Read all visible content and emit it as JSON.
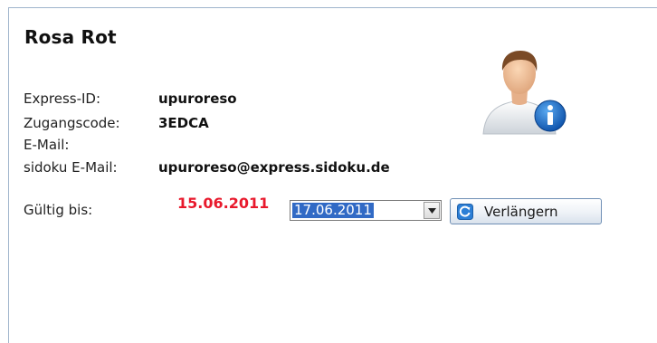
{
  "user": {
    "name": "Rosa Rot"
  },
  "fields": [
    {
      "label": "Express-ID:",
      "value": "upuroreso"
    },
    {
      "label": "Zugangscode:",
      "value": "3EDCA"
    },
    {
      "label": "E-Mail:",
      "value": ""
    },
    {
      "label": "sidoku E-Mail:",
      "value": "upuroreso@express.sidoku.de"
    }
  ],
  "validity": {
    "label": "Gültig bis:",
    "current_date": "15.06.2011",
    "selected_new_date": "17.06.2011",
    "extend_button": "Verlängern"
  },
  "colors": {
    "expiry_red": "#e8192c",
    "selection_blue": "#316ac5",
    "info_blue": "#1565c0"
  },
  "icons": {
    "avatar": "user-info-icon",
    "dropdown": "chevron-down-icon",
    "button": "refresh-icon"
  }
}
